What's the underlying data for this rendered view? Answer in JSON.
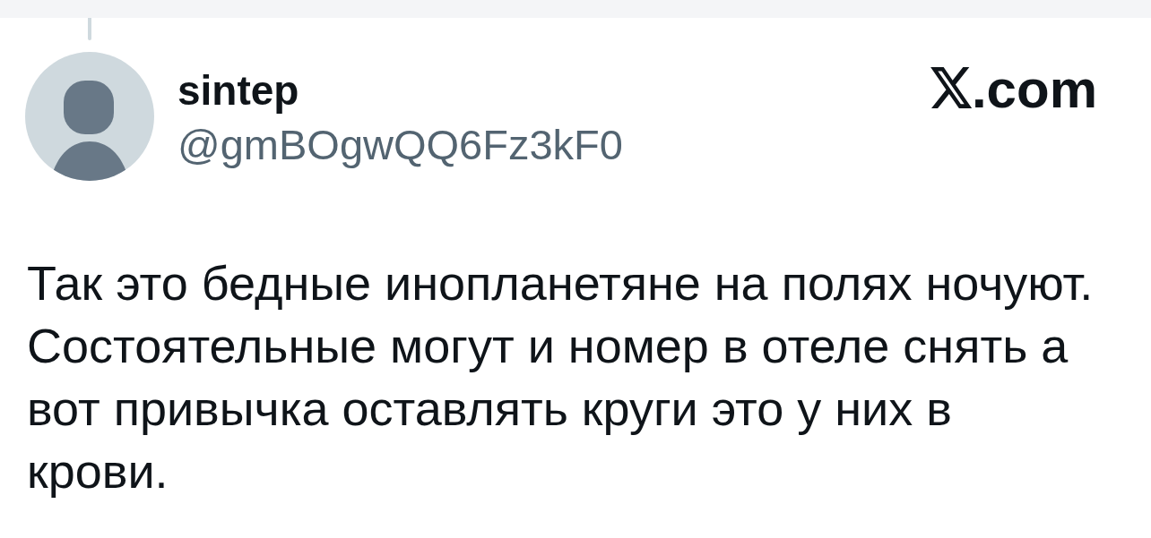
{
  "post": {
    "author": {
      "name": "sintep",
      "handle": "@gmBOgwQQ6Fz3kF0"
    },
    "site": {
      "label": ".com"
    },
    "text": "Так это бедные инопланетяне на полях ночуют. Состоятельные могут и номер в отеле снять а вот привычка оставлять круги это у них в крови."
  }
}
